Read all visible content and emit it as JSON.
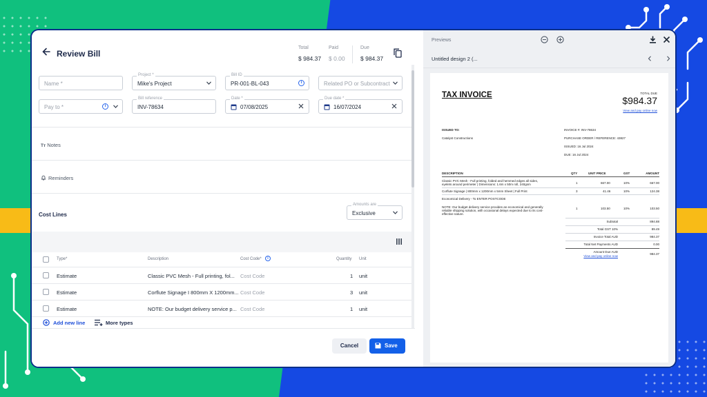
{
  "header": {
    "title": "Review Bill",
    "total_label": "Total",
    "total_value": "$ 984.37",
    "paid_label": "Paid",
    "paid_value": "$ 0.00",
    "due_label": "Due",
    "due_value": "$ 984.37"
  },
  "form": {
    "name_placeholder": "Name *",
    "project_label": "Project *",
    "project_value": "Mike's Project",
    "bill_id_label": "Bill ID",
    "bill_id_value": "PR-001-BL-043",
    "related_placeholder": "Related PO or Subcontract",
    "pay_to_placeholder": "Pay to *",
    "bill_ref_label": "Bill reference",
    "bill_ref_value": "INV-78634",
    "date_label": "Date *",
    "date_value": "07/08/2025",
    "due_date_label": "Due date *",
    "due_date_value": "16/07/2024"
  },
  "sections": {
    "notes": "Notes",
    "reminders": "Reminders"
  },
  "cost_lines": {
    "title": "Cost Lines",
    "amounts_label": "Amounts are",
    "amounts_value": "Exclusive",
    "columns": {
      "type": "Type*",
      "description": "Description",
      "cost_code": "Cost Code*",
      "quantity": "Quantity",
      "unit": "Unit"
    },
    "rows": [
      {
        "type": "Estimate",
        "description": "Classic PVC Mesh - Full printing, fol...",
        "cost_code": "Cost Code",
        "quantity": "1",
        "unit": "unit"
      },
      {
        "type": "Estimate",
        "description": "Corflute Signage I 800mm X 1200mm...",
        "cost_code": "Cost Code",
        "quantity": "3",
        "unit": "unit"
      },
      {
        "type": "Estimate",
        "description": "NOTE: Our budget delivery service p...",
        "cost_code": "Cost Code",
        "quantity": "1",
        "unit": "unit"
      }
    ],
    "add_line": "Add new line",
    "more_types": "More types"
  },
  "footer": {
    "cancel": "Cancel",
    "save": "Save"
  },
  "preview": {
    "title": "Previews",
    "document_name": "Untitled design 2 (...",
    "invoice": {
      "heading": "TAX INVOICE",
      "total_due_label": "TOTAL DUE",
      "total_due_value": "$984.37",
      "pay_online": "View and pay online now",
      "issued_to_label": "ISSUED TO:",
      "issued_to_value": "Catalyst Constructions",
      "invoice_no": "INVOICE #: INV-78634",
      "po_ref": "PURCHASE ORDER / REFERENCE: 43827",
      "issued": "ISSUED: 16 Jul 2024",
      "due": "DUE: 16 Jul 2024",
      "col_description": "DESCRIPTION",
      "col_qty": "QTY",
      "col_unit_price": "UNIT PRICE",
      "col_gst": "GST",
      "col_amount": "AMOUNT",
      "lines": [
        {
          "desc1": "Classic PVC Mesh - Full printing, folded and hemmed edges all sides,",
          "desc2": "eyelets around perimeter | Dimensions: 1.6m x 50m roll, 240gsm",
          "qty": "1",
          "price": "667.00",
          "gst": "10%",
          "amount": "667.00"
        },
        {
          "desc1": "Corflute Signage | 800mm x 1200mm x 5mm Sheet | Full Print",
          "desc2": "",
          "qty": "3",
          "price": "41.46",
          "gst": "10%",
          "amount": "124.38"
        },
        {
          "desc1": "Economical Delivery - To ENTER POSTCODE",
          "desc2": "",
          "qty": "",
          "price": "",
          "gst": "",
          "amount": ""
        },
        {
          "desc1": "NOTE: Our budget delivery service provides an economical and generally",
          "desc2": "reliable shipping solution, with occasional delays expected due to its cost-",
          "desc3": "effective nature.",
          "qty": "1",
          "price": "103.50",
          "gst": "10%",
          "amount": "103.50"
        }
      ],
      "subtotal_label": "Subtotal",
      "subtotal_value": "894.88",
      "gst_label": "Total GST 10%",
      "gst_value": "89.49",
      "invoice_total_label": "Invoice Total AUD",
      "invoice_total_value": "984.37",
      "net_payments_label": "Total Net Payments AUD",
      "net_payments_value": "0.00",
      "amount_due_label": "Amount Due AUD",
      "amount_due_value": "984.37"
    }
  },
  "colors": {
    "accent": "#1360e8",
    "bg_green": "#10c07e",
    "bg_blue": "#1549e3",
    "stripe": "#f8bb17"
  }
}
